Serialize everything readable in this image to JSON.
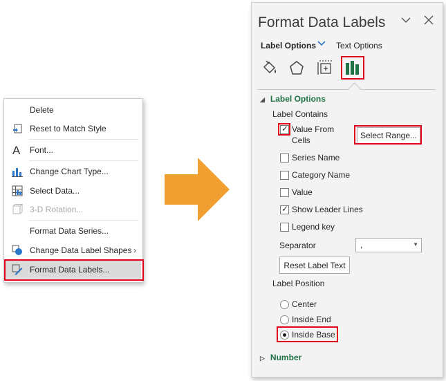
{
  "context_menu": {
    "items": [
      {
        "label": "Delete",
        "icon": "none",
        "enabled": true
      },
      {
        "label": "Reset to Match Style",
        "icon": "reset-style-icon",
        "enabled": true
      },
      {
        "label": "Font...",
        "icon": "font-icon",
        "enabled": true
      },
      {
        "label": "Change Chart Type...",
        "icon": "chart-type-icon",
        "enabled": true
      },
      {
        "label": "Select Data...",
        "icon": "select-data-icon",
        "enabled": true
      },
      {
        "label": "3-D Rotation...",
        "icon": "rotation-3d-icon",
        "enabled": false
      },
      {
        "label": "Format Data Series...",
        "icon": "none",
        "enabled": true
      },
      {
        "label": "Change Data Label Shapes",
        "icon": "shapes-icon",
        "enabled": true,
        "submenu": true
      },
      {
        "label": "Format Data Labels...",
        "icon": "format-labels-icon",
        "enabled": true,
        "highlighted": true
      }
    ],
    "submenu_glyph": "›"
  },
  "pane": {
    "title": "Format Data Labels",
    "tabs": {
      "label_options": "Label Options",
      "text_options": "Text Options"
    },
    "section_label_options": "Label Options",
    "label_contains": "Label Contains",
    "checkboxes": {
      "value_from_cells": {
        "label_line1": "Value From",
        "label_line2": "Cells",
        "checked": true
      },
      "series_name": {
        "label": "Series Name",
        "checked": false
      },
      "category_name": {
        "label": "Category Name",
        "checked": false
      },
      "value": {
        "label": "Value",
        "checked": false
      },
      "show_leader_lines": {
        "label": "Show Leader Lines",
        "checked": true
      },
      "legend_key": {
        "label": "Legend key",
        "checked": false
      }
    },
    "select_range_button": "Select Range...",
    "separator_label": "Separator",
    "separator_value": ",",
    "reset_button": "Reset Label Text",
    "label_position": "Label Position",
    "radios": {
      "center": {
        "label": "Center",
        "selected": false
      },
      "inside_end": {
        "label": "Inside End",
        "selected": false
      },
      "inside_base": {
        "label": "Inside Base",
        "selected": true
      }
    },
    "section_number": "Number",
    "tick": "✓"
  },
  "colors": {
    "highlight_red": "#e0001b",
    "arrow_orange": "#f0a030",
    "section_green": "#217346",
    "chart_icon_green": "#217346"
  }
}
